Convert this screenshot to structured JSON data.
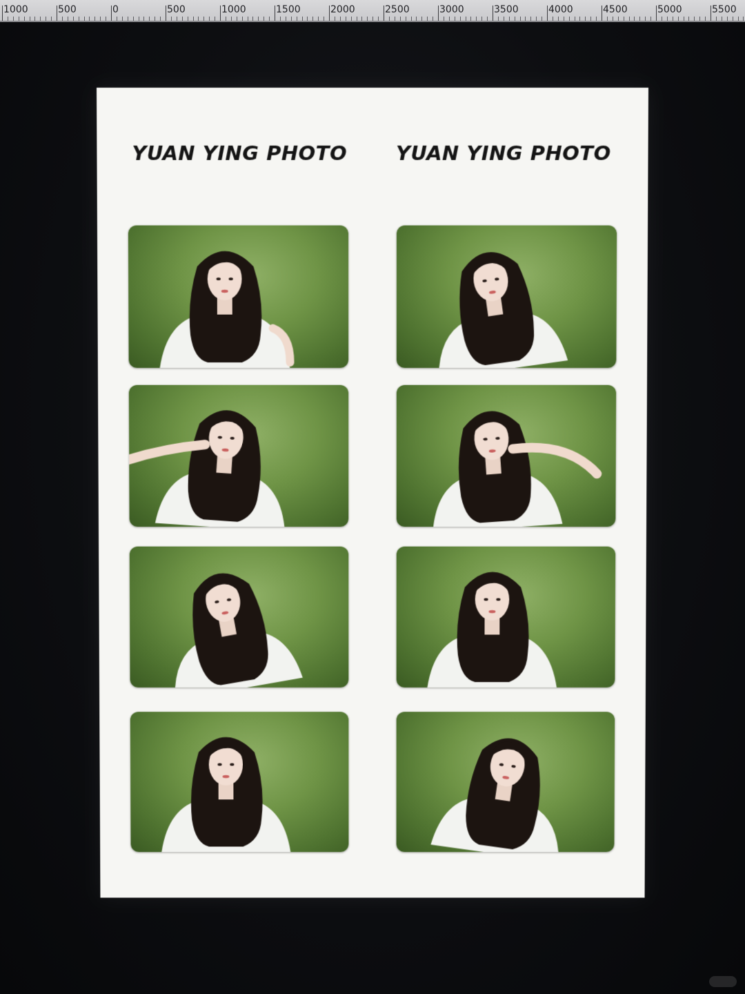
{
  "ruler": {
    "labels": [
      "1000",
      "500",
      "0",
      "500",
      "1000",
      "1500",
      "2000",
      "2500",
      "3000",
      "3500",
      "4000",
      "4500",
      "5000",
      "5500"
    ]
  },
  "document": {
    "brand_left": "YUAN YING PHOTO",
    "brand_right": "YUAN YING PHOTO"
  },
  "photos": [
    {
      "pose": "hand-in-hair",
      "tilt": 0
    },
    {
      "pose": "head-tilt",
      "tilt": -8
    },
    {
      "pose": "peace-sign-left",
      "tilt": 4
    },
    {
      "pose": "finger-point-right",
      "tilt": -4
    },
    {
      "pose": "head-tilt",
      "tilt": -10
    },
    {
      "pose": "straight",
      "tilt": 0
    },
    {
      "pose": "straight",
      "tilt": 0
    },
    {
      "pose": "side-turn",
      "tilt": 8
    }
  ],
  "colors": {
    "backdrop_green": "#6f9446",
    "hair": "#1c1410",
    "shirt": "#f2f3f0",
    "paper": "#f6f6f3"
  }
}
